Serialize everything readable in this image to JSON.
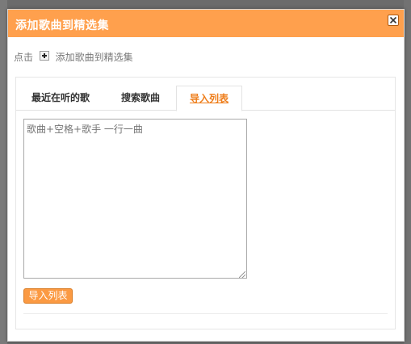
{
  "modal": {
    "title": "添加歌曲到精选集",
    "close_label": "×"
  },
  "hint": {
    "prefix": "点击",
    "suffix": "添加歌曲到精选集"
  },
  "tabs": [
    {
      "label": "最近在听的歌",
      "active": false
    },
    {
      "label": "搜索歌曲",
      "active": false
    },
    {
      "label": "导入列表",
      "active": true
    }
  ],
  "import": {
    "textarea_placeholder": "歌曲+空格+歌手 一行一曲",
    "button_label": "导入列表"
  },
  "colors": {
    "header": "#ffa04d",
    "active_tab": "#ee7d1a",
    "button": "#fb9a43"
  }
}
